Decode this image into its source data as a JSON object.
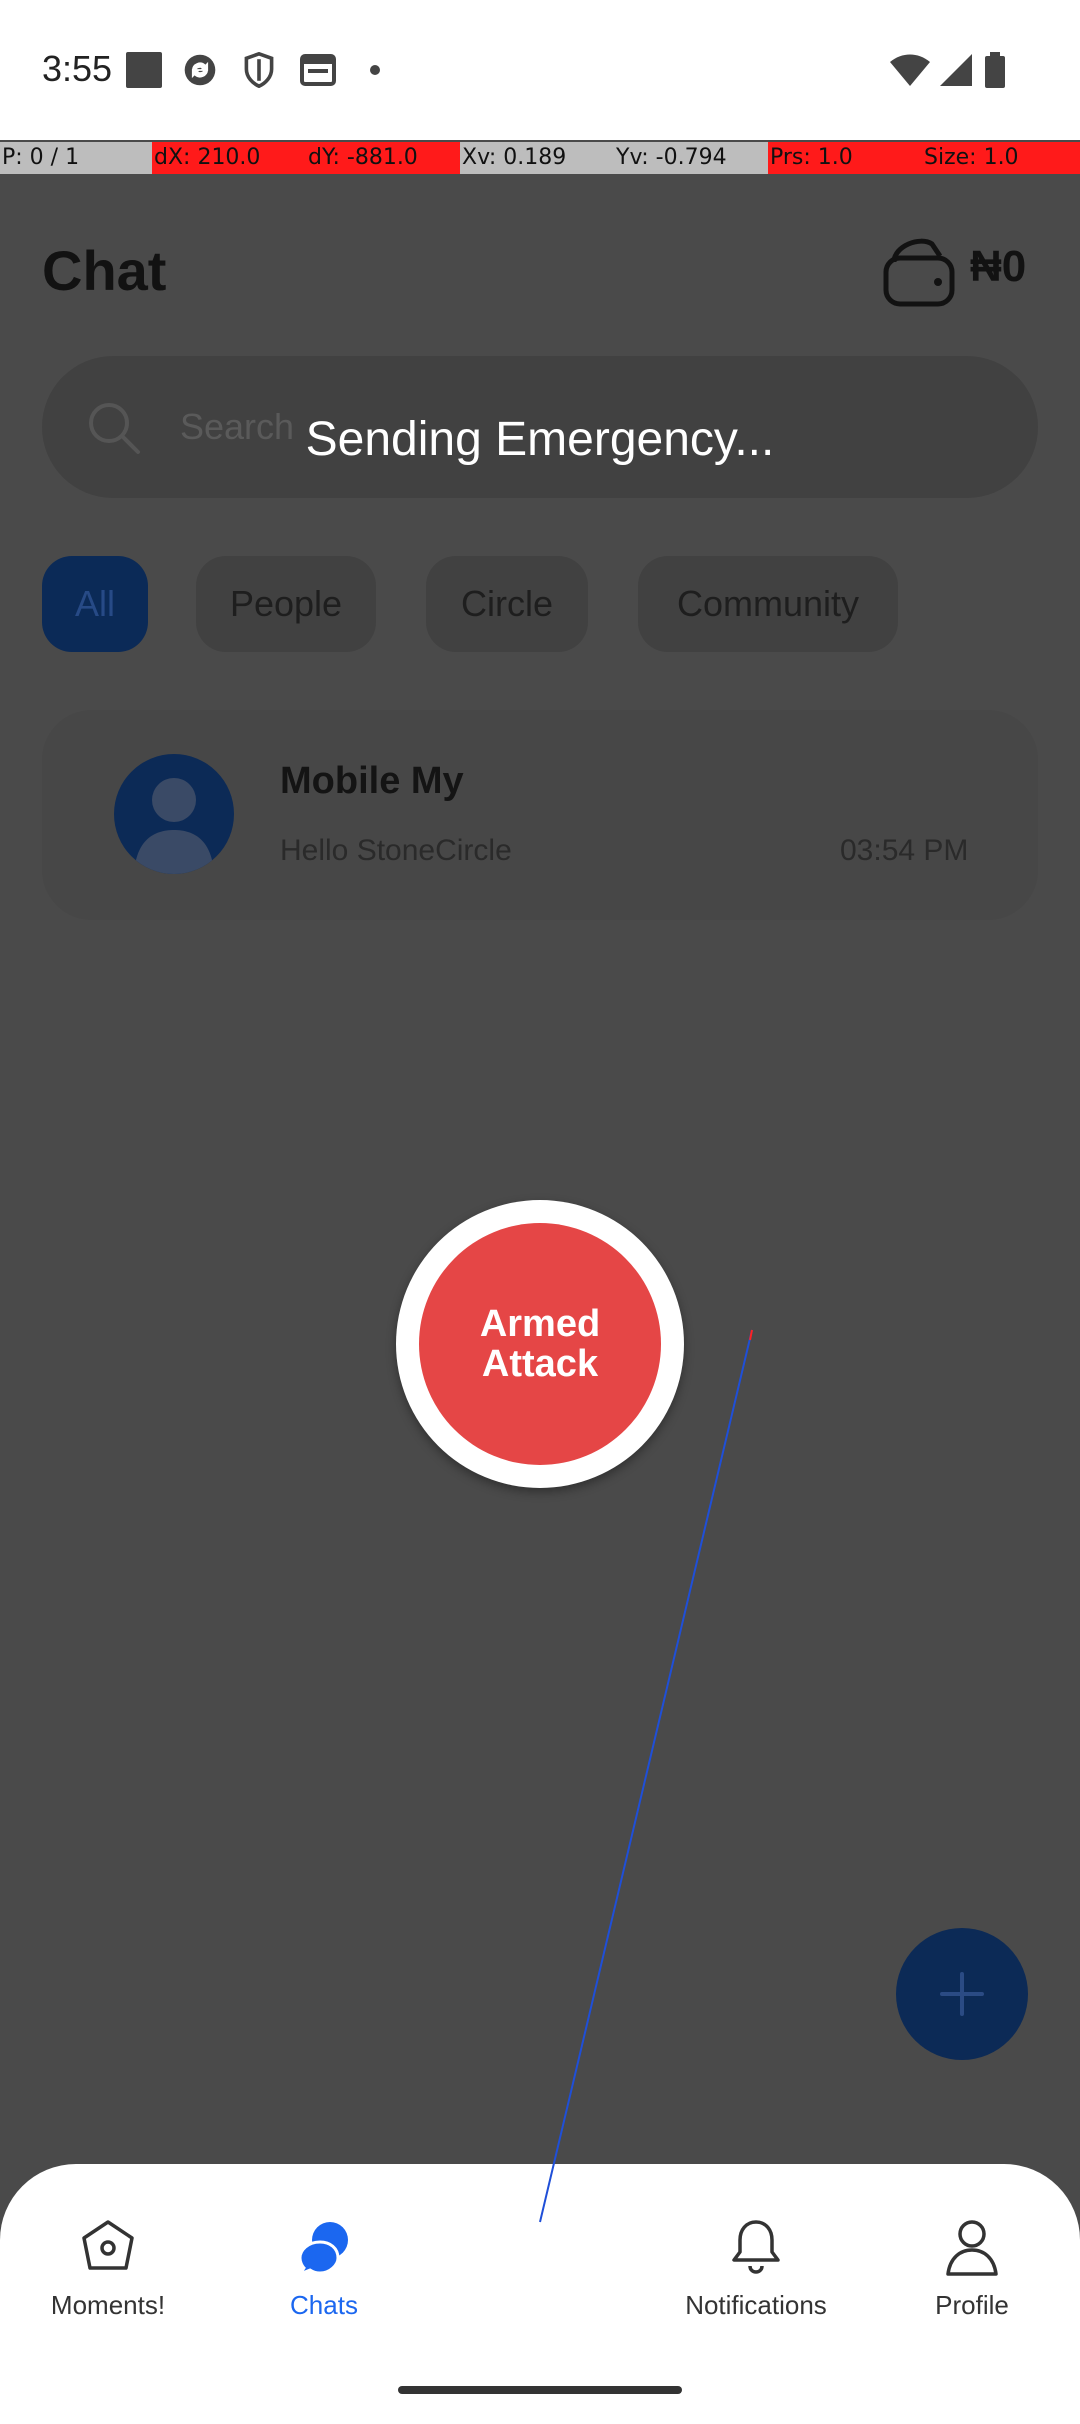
{
  "status_bar": {
    "time": "3:55",
    "icons": [
      "square-notification-icon",
      "sync-icon",
      "shield-icon",
      "calendar-icon",
      "dot-icon",
      "wifi-icon",
      "signal-icon",
      "battery-icon"
    ]
  },
  "pointer_location": {
    "p": "P: 0 / 1",
    "dx": "dX: 210.0",
    "dy": "dY: -881.0",
    "xv": "Xv: 0.189",
    "yv": "Yv: -0.794",
    "prs": "Prs: 1.0",
    "size": "Size: 1.0"
  },
  "header": {
    "title": "Chat",
    "balance": "₦0"
  },
  "search": {
    "placeholder": "Search"
  },
  "overlay": {
    "message": "Sending Emergency..."
  },
  "filters": [
    {
      "label": "All",
      "active": true
    },
    {
      "label": "People",
      "active": false
    },
    {
      "label": "Circle",
      "active": false
    },
    {
      "label": "Community",
      "active": false
    }
  ],
  "chats": [
    {
      "name": "Mobile My",
      "message": "Hello StoneCircle",
      "time": "03:54 PM"
    }
  ],
  "emergency": {
    "line1": "Armed",
    "line2": "Attack"
  },
  "bottom_nav": [
    {
      "label": "Moments!",
      "icon": "moments-icon",
      "active": false
    },
    {
      "label": "Chats",
      "icon": "chat-bubbles-icon",
      "active": true
    },
    {
      "label": "Notifications",
      "icon": "bell-icon",
      "active": false
    },
    {
      "label": "Profile",
      "icon": "person-icon",
      "active": false
    }
  ],
  "colors": {
    "accent": "#1b67f0",
    "emergency": "#e54646",
    "overlay_dim": "#4a4a4a"
  }
}
